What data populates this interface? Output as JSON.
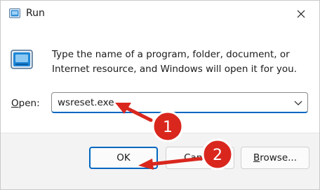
{
  "window": {
    "title": "Run",
    "title_icon": "run-app-icon",
    "close_icon": "close-icon"
  },
  "body": {
    "icon": "run-dialog-icon",
    "description": "Type the name of a program, folder, document, or Internet resource, and Windows will open it for you.",
    "open_label_first": "O",
    "open_label_rest": "pen:",
    "input_value": "wsreset.exe",
    "dropdown_icon": "chevron-down-icon"
  },
  "buttons": {
    "ok": "OK",
    "cancel": "Cancel",
    "browse_first": "B",
    "browse_rest": "rowse..."
  },
  "annotations": {
    "badge1": "1",
    "badge2": "2",
    "color": "#d9271e"
  }
}
